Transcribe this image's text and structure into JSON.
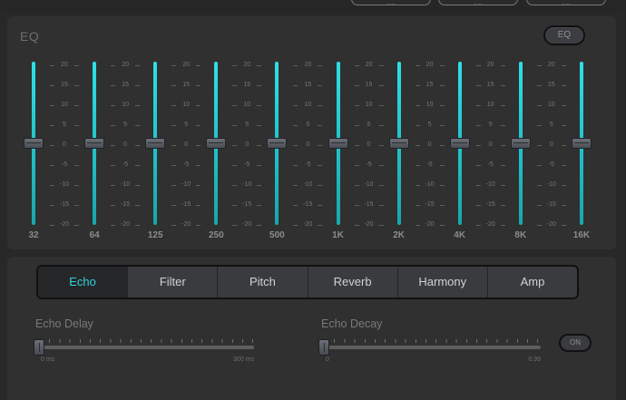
{
  "top_buttons": [
    {
      "label": "...."
    },
    {
      "label": "...."
    },
    {
      "label": "...."
    }
  ],
  "eq": {
    "title": "EQ",
    "toggle_label": "EQ",
    "scale_labels": [
      "20",
      "15",
      "10",
      "5",
      "0",
      "-5",
      "-10",
      "-15",
      "-20"
    ],
    "bands": [
      {
        "freq": "32",
        "gain_db": 0
      },
      {
        "freq": "64",
        "gain_db": 0
      },
      {
        "freq": "125",
        "gain_db": 0
      },
      {
        "freq": "250",
        "gain_db": 0
      },
      {
        "freq": "500",
        "gain_db": 0
      },
      {
        "freq": "1K",
        "gain_db": 0
      },
      {
        "freq": "2K",
        "gain_db": 0
      },
      {
        "freq": "4K",
        "gain_db": 0
      },
      {
        "freq": "8K",
        "gain_db": 0
      },
      {
        "freq": "16K",
        "gain_db": 0
      }
    ],
    "accent_color": "#2ee0e6"
  },
  "effects": {
    "tabs": [
      "Echo",
      "Filter",
      "Pitch",
      "Reverb",
      "Harmony",
      "Amp"
    ],
    "active_tab": "Echo",
    "echo_delay": {
      "label": "Echo Delay",
      "min_label": "0 ms",
      "max_label": "300 ms",
      "value": 0
    },
    "echo_decay": {
      "label": "Echo Decay",
      "min_label": "0",
      "max_label": "0.99",
      "value": 0
    },
    "toggle_label": "ON"
  }
}
